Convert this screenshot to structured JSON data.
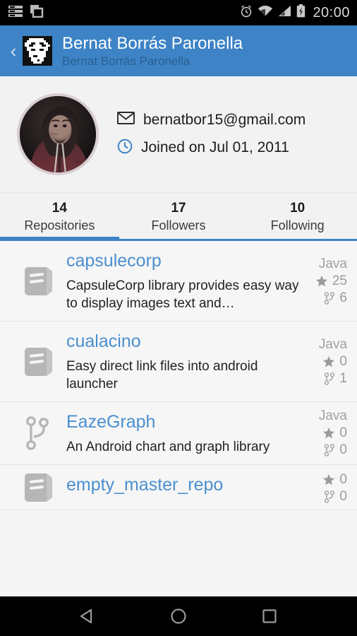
{
  "status_bar": {
    "time": "20:00",
    "notification_icons": [
      "list-lines-icon",
      "layers-icon"
    ],
    "system_icons": [
      "alarm-icon",
      "wifi-icon",
      "signal-icon",
      "battery-charging-icon"
    ]
  },
  "action_bar": {
    "back_icon": "back-chevron-icon",
    "avatar_icon": "pixel-avatar-icon",
    "title": "Bernat Borrás Paronella",
    "subtitle": "Bernat Borrás Paronella",
    "background_color": "#3d83c6"
  },
  "profile": {
    "avatar_alt": "user-avatar-photo",
    "email_icon": "envelope-icon",
    "email": "bernatbor15@gmail.com",
    "joined_icon": "clock-icon",
    "joined": "Joined on Jul 01, 2011"
  },
  "tabs": {
    "selected_index": 0,
    "accent_color": "#3d83c6",
    "items": [
      {
        "count": "14",
        "label": "Repositories"
      },
      {
        "count": "17",
        "label": "Followers"
      },
      {
        "count": "10",
        "label": "Following"
      }
    ]
  },
  "repositories": [
    {
      "icon": "book-repo-icon",
      "name": "capsulecorp",
      "description": "CapsuleCorp library provides easy way to display images text and…",
      "language": "Java",
      "stars": "25",
      "forks": "6"
    },
    {
      "icon": "book-repo-icon",
      "name": "cualacino",
      "description": "Easy direct link files into android launcher",
      "language": "Java",
      "stars": "0",
      "forks": "1"
    },
    {
      "icon": "fork-repo-icon",
      "name": "EazeGraph",
      "description": "An Android chart and graph library",
      "language": "Java",
      "stars": "0",
      "forks": "0"
    },
    {
      "icon": "book-repo-icon",
      "name": "empty_master_repo",
      "description": "",
      "language": "",
      "stars": "0",
      "forks": "0"
    }
  ],
  "nav_bar": {
    "back_label": "back-triangle-icon",
    "home_label": "home-circle-icon",
    "recents_label": "recents-square-icon"
  }
}
